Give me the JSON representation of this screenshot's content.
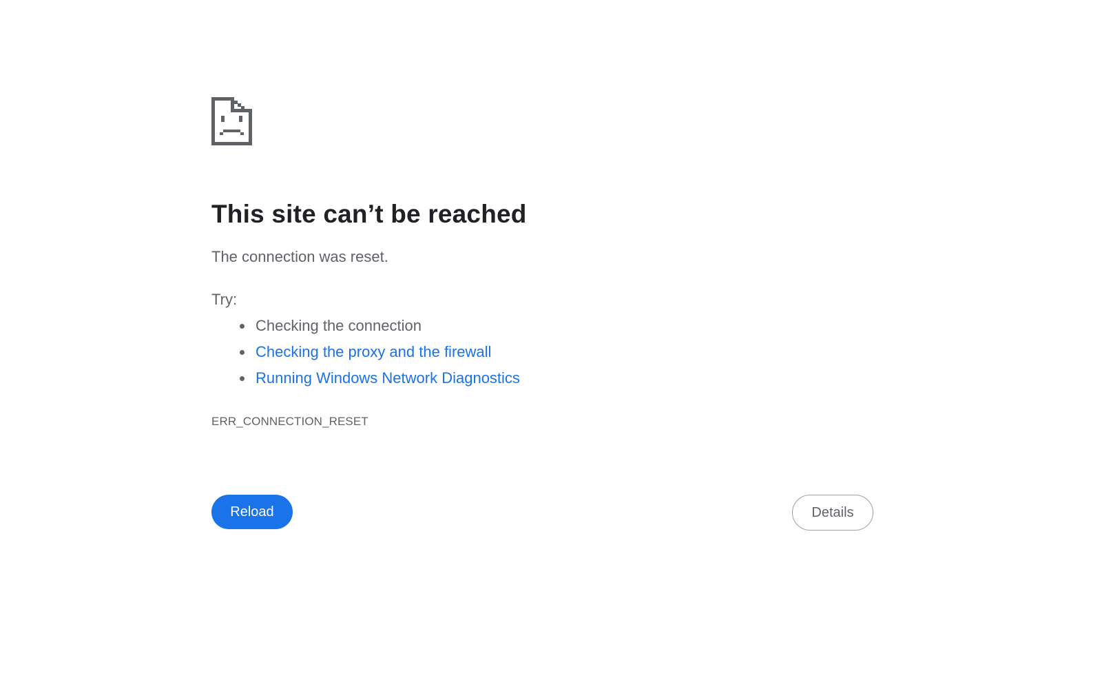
{
  "icon": {
    "name": "sad-document-icon",
    "color": "#5f6368"
  },
  "error": {
    "title": "This site can’t be reached",
    "subtitle": "The connection was reset.",
    "try_label": "Try:",
    "suggestions": [
      {
        "label": "Checking the connection",
        "is_link": false
      },
      {
        "label": "Checking the proxy and the firewall",
        "is_link": true
      },
      {
        "label": "Running Windows Network Diagnostics",
        "is_link": true
      }
    ],
    "code": "ERR_CONNECTION_RESET"
  },
  "buttons": {
    "reload_label": "Reload",
    "details_label": "Details"
  },
  "colors": {
    "accent": "#1a73e8",
    "title_text": "#202124",
    "body_text": "#5f6368",
    "background": "#ffffff"
  }
}
